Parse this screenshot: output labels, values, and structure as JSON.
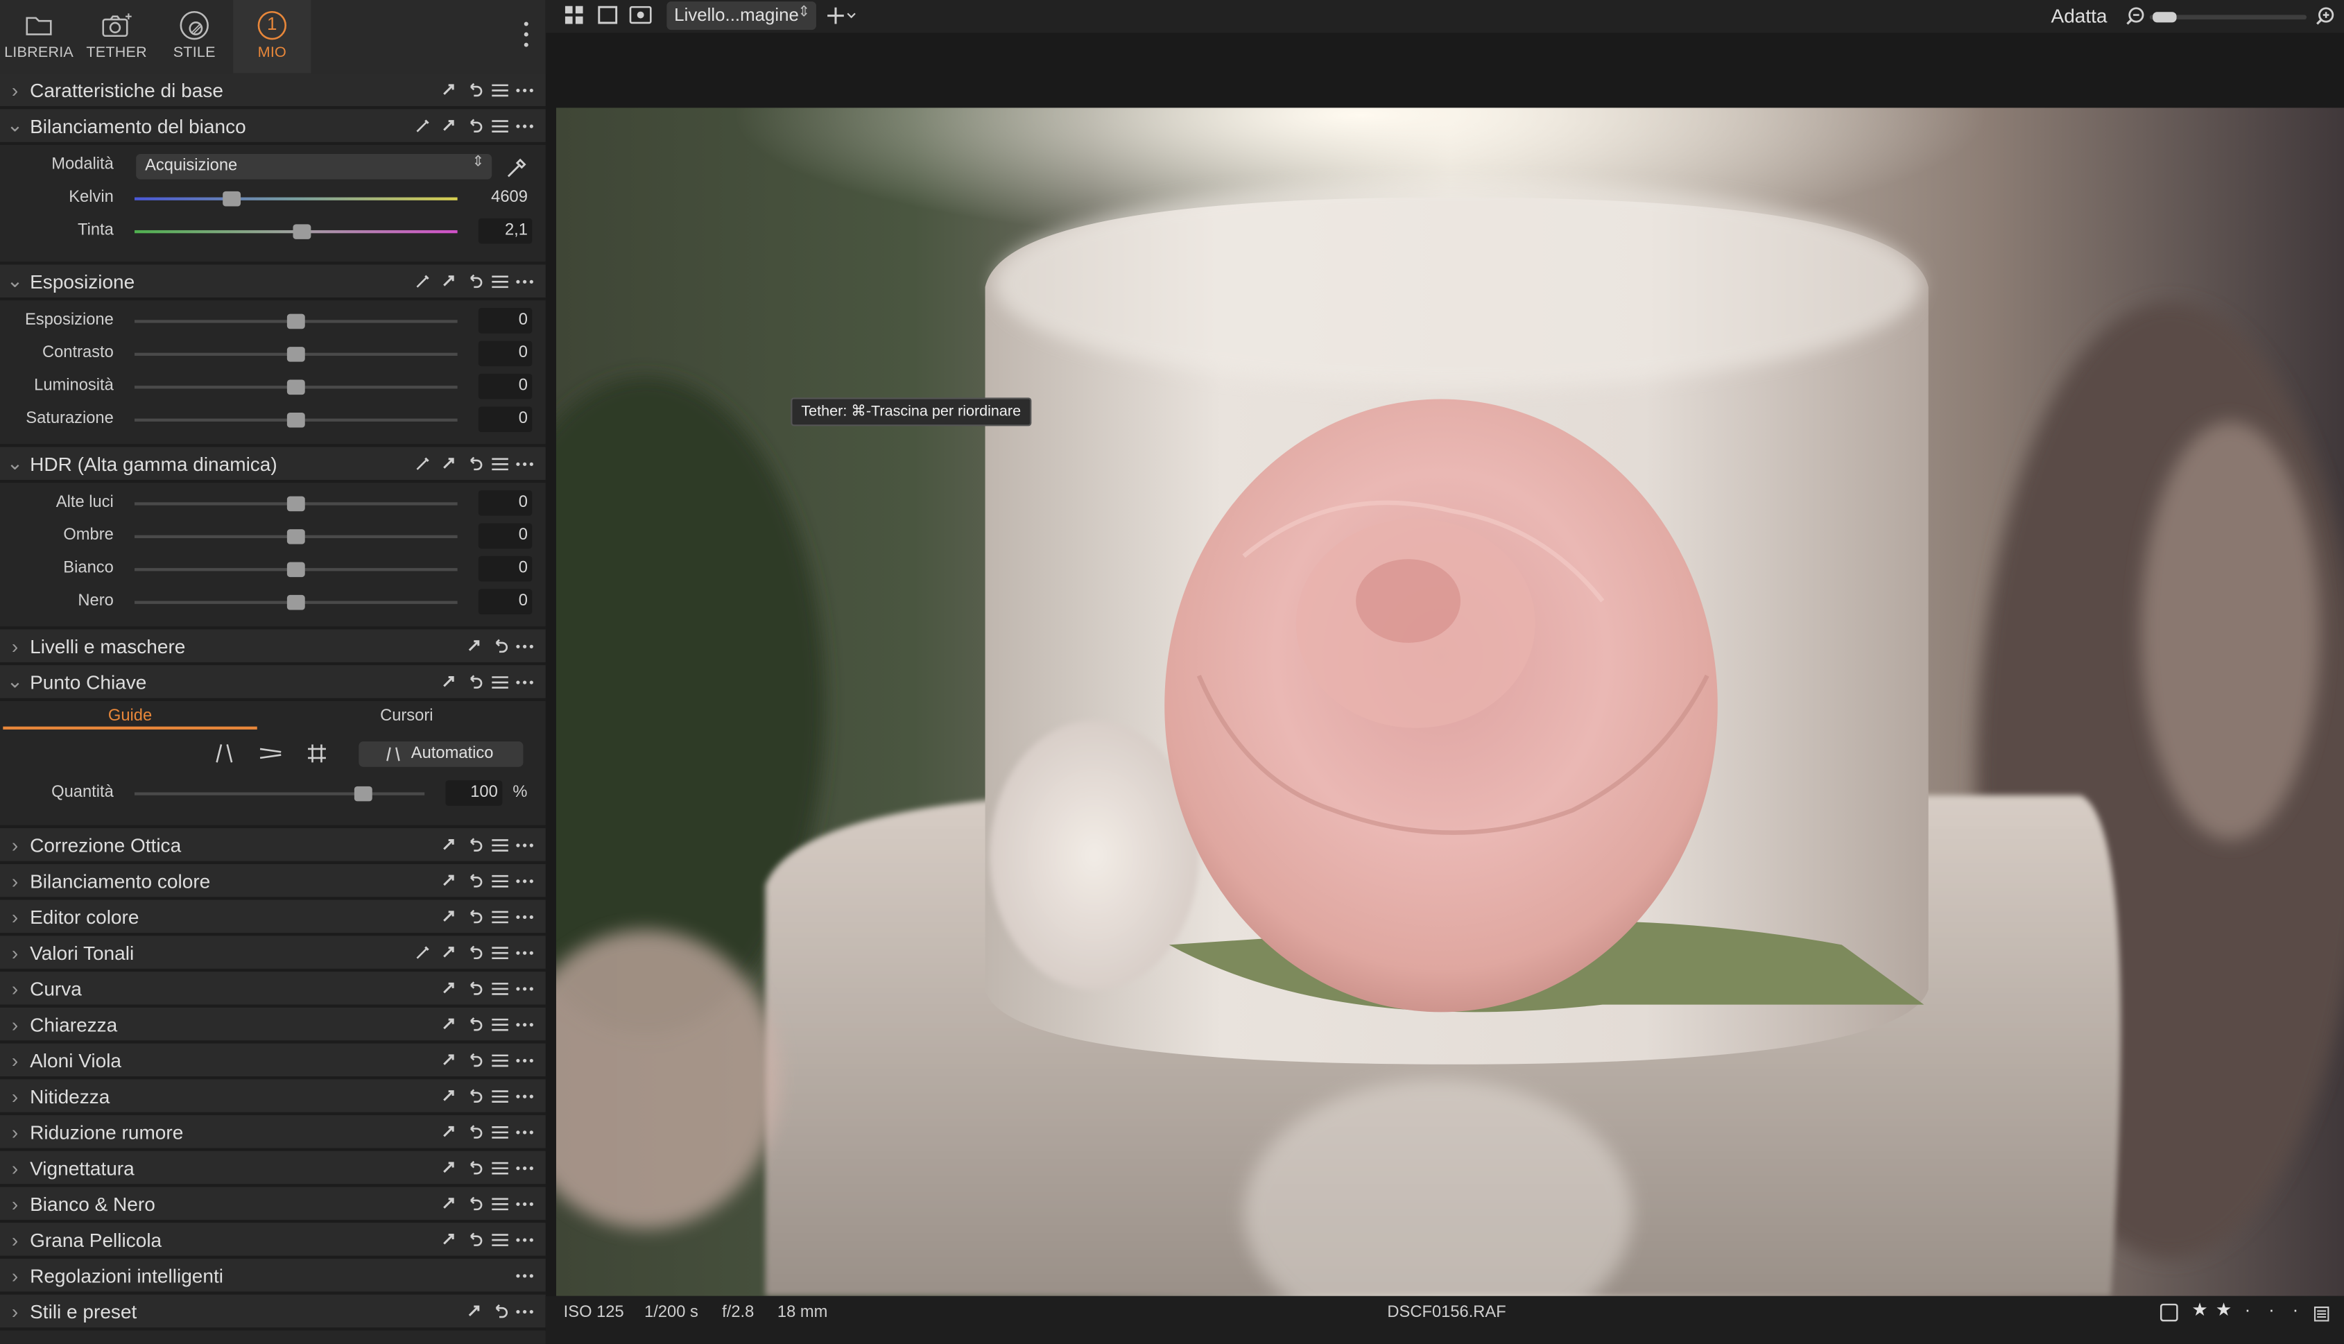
{
  "tabs": [
    {
      "label": "LIBRERIA",
      "icon": "folder-icon"
    },
    {
      "label": "TETHER",
      "icon": "camera-icon"
    },
    {
      "label": "STILE",
      "icon": "style-icon"
    },
    {
      "label": "MIO",
      "icon": "numbered-circle-icon",
      "badge": "1",
      "active": true
    }
  ],
  "tools": {
    "base": {
      "title": "Caratteristiche di base"
    },
    "white_balance": {
      "title": "Bilanciamento del bianco",
      "mode_label": "Modalità",
      "mode_value": "Acquisizione",
      "kelvin": {
        "label": "Kelvin",
        "value": "4609",
        "position": 0.3
      },
      "tint": {
        "label": "Tinta",
        "value": "2,1",
        "position": 0.52
      }
    },
    "exposure": {
      "title": "Esposizione",
      "sliders": [
        {
          "label": "Esposizione",
          "value": "0",
          "position": 0.5
        },
        {
          "label": "Contrasto",
          "value": "0",
          "position": 0.5
        },
        {
          "label": "Luminosità",
          "value": "0",
          "position": 0.5
        },
        {
          "label": "Saturazione",
          "value": "0",
          "position": 0.5
        }
      ]
    },
    "hdr": {
      "title": "HDR (Alta gamma dinamica)",
      "sliders": [
        {
          "label": "Alte luci",
          "value": "0",
          "position": 0.5
        },
        {
          "label": "Ombre",
          "value": "0",
          "position": 0.5
        },
        {
          "label": "Bianco",
          "value": "0",
          "position": 0.5
        },
        {
          "label": "Nero",
          "value": "0",
          "position": 0.5
        }
      ]
    },
    "layers": {
      "title": "Livelli e maschere"
    },
    "keystone": {
      "title": "Punto Chiave",
      "subtab_guides": "Guide",
      "subtab_cursors": "Cursori",
      "auto_label": "Automatico",
      "amount_label": "Quantità",
      "amount_value": "100",
      "amount_unit": "%",
      "amount_position": 0.79
    },
    "collapsed": [
      {
        "title": "Correzione Ottica"
      },
      {
        "title": "Bilanciamento colore"
      },
      {
        "title": "Editor colore"
      },
      {
        "title": "Valori Tonali"
      },
      {
        "title": "Curva"
      },
      {
        "title": "Chiarezza"
      },
      {
        "title": "Aloni Viola"
      },
      {
        "title": "Nitidezza"
      },
      {
        "title": "Riduzione rumore"
      },
      {
        "title": "Vignettatura"
      },
      {
        "title": "Bianco & Nero"
      },
      {
        "title": "Grana Pellicola"
      },
      {
        "title": "Regolazioni intelligenti"
      },
      {
        "title": "Stili e preset"
      }
    ]
  },
  "viewer": {
    "layer_select": "Livello...magine",
    "zoom_label": "Adatta",
    "tooltip": "Tether: ⌘-Trascina per riordinare",
    "meta": {
      "iso": "ISO 125",
      "shutter": "1/200 s",
      "aperture": "f/2.8",
      "focal": "18 mm"
    },
    "filename": "DSCF0156.RAF",
    "rating_stars": 2,
    "rating_max": 5
  },
  "colors": {
    "accent": "#e8873a",
    "panel": "#262626",
    "header": "#2b2b2b"
  }
}
